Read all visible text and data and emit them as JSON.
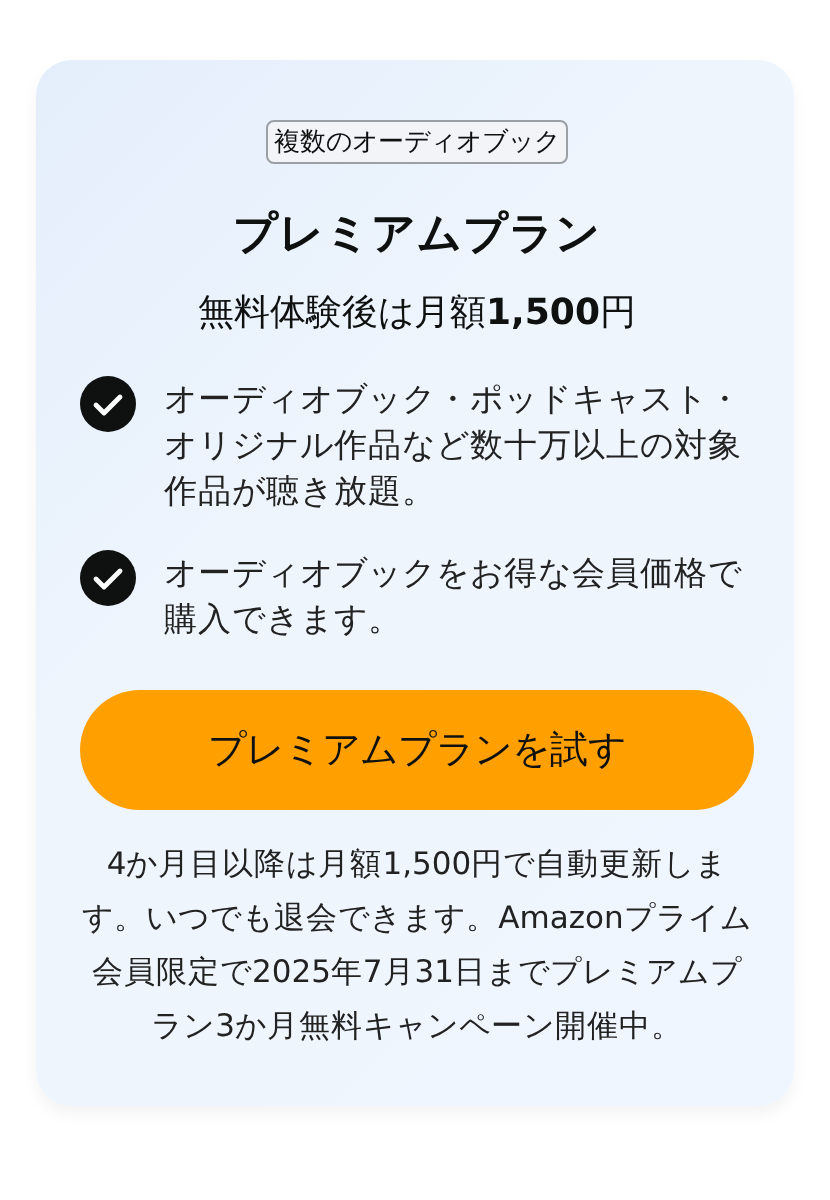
{
  "badge": "複数のオーディオブック",
  "title": "プレミアムプラン",
  "subtitle": "無料体験後は月額**1,500**円",
  "features": [
    {
      "text": "オーディオブック・ポッドキャスト・オリジナル作品など数十万以上の対象作品が聴き放題。",
      "checked": true
    },
    {
      "text": "オーディオブックをお得な会員価格で購入できます。",
      "checked": true
    }
  ],
  "button": "プレミアムプランを試す",
  "note": "4か月目以降は月額1,500円で自動更新します。いつでも退会できます。Amazonプライム会員限定で2025年7月31日までプレミアムプラン3か月無料キャンペーン開催中。"
}
